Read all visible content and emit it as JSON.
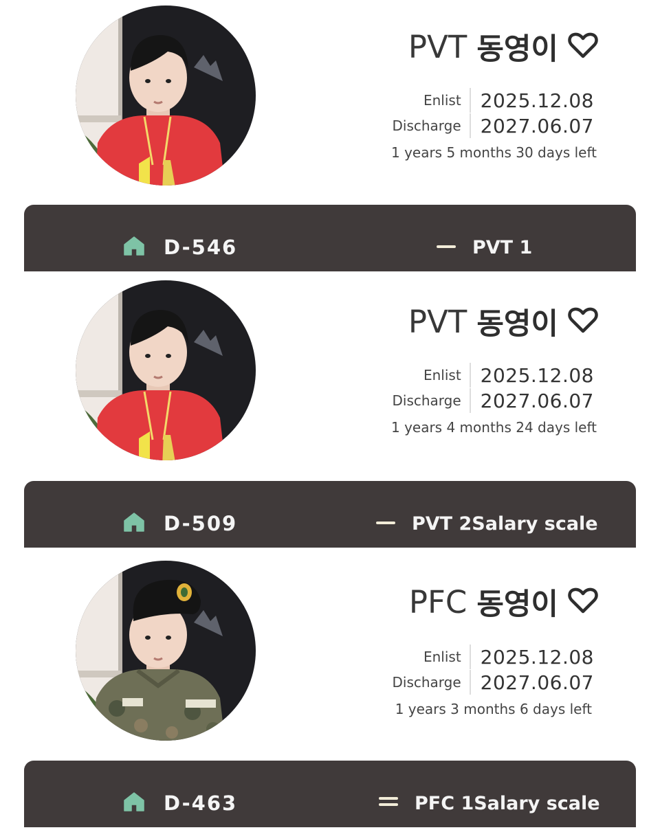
{
  "colors": {
    "bar_background": "#403a3a",
    "home_icon": "#7ec3a6",
    "stripe_icon": "#f2ecd8",
    "text_dark": "#333333"
  },
  "cards": [
    {
      "rank": "PVT",
      "nickname": "동영이",
      "heart_icon": "heart-outline-icon",
      "enlist_label": "Enlist",
      "enlist_date": "2025.12.08",
      "discharge_label": "Discharge",
      "discharge_date": "2027.06.07",
      "time_left": "1 years 5 months 30 days left",
      "dday": "D-546",
      "rank_detail": "PVT 1",
      "stripe_icon": "one-stripe-icon"
    },
    {
      "rank": "PVT",
      "nickname": "동영이",
      "heart_icon": "heart-outline-icon",
      "enlist_label": "Enlist",
      "enlist_date": "2025.12.08",
      "discharge_label": "Discharge",
      "discharge_date": "2027.06.07",
      "time_left": "1 years 4 months 24 days left",
      "dday": "D-509",
      "rank_detail": "PVT 2Salary scale",
      "stripe_icon": "one-stripe-icon"
    },
    {
      "rank": "PFC",
      "nickname": "동영이",
      "heart_icon": "heart-outline-icon",
      "enlist_label": "Enlist",
      "enlist_date": "2025.12.08",
      "discharge_label": "Discharge",
      "discharge_date": "2027.06.07",
      "time_left": "1 years 3 months 6 days left",
      "dday": "D-463",
      "rank_detail": "PFC 1Salary scale",
      "stripe_icon": "two-stripe-icon"
    }
  ]
}
